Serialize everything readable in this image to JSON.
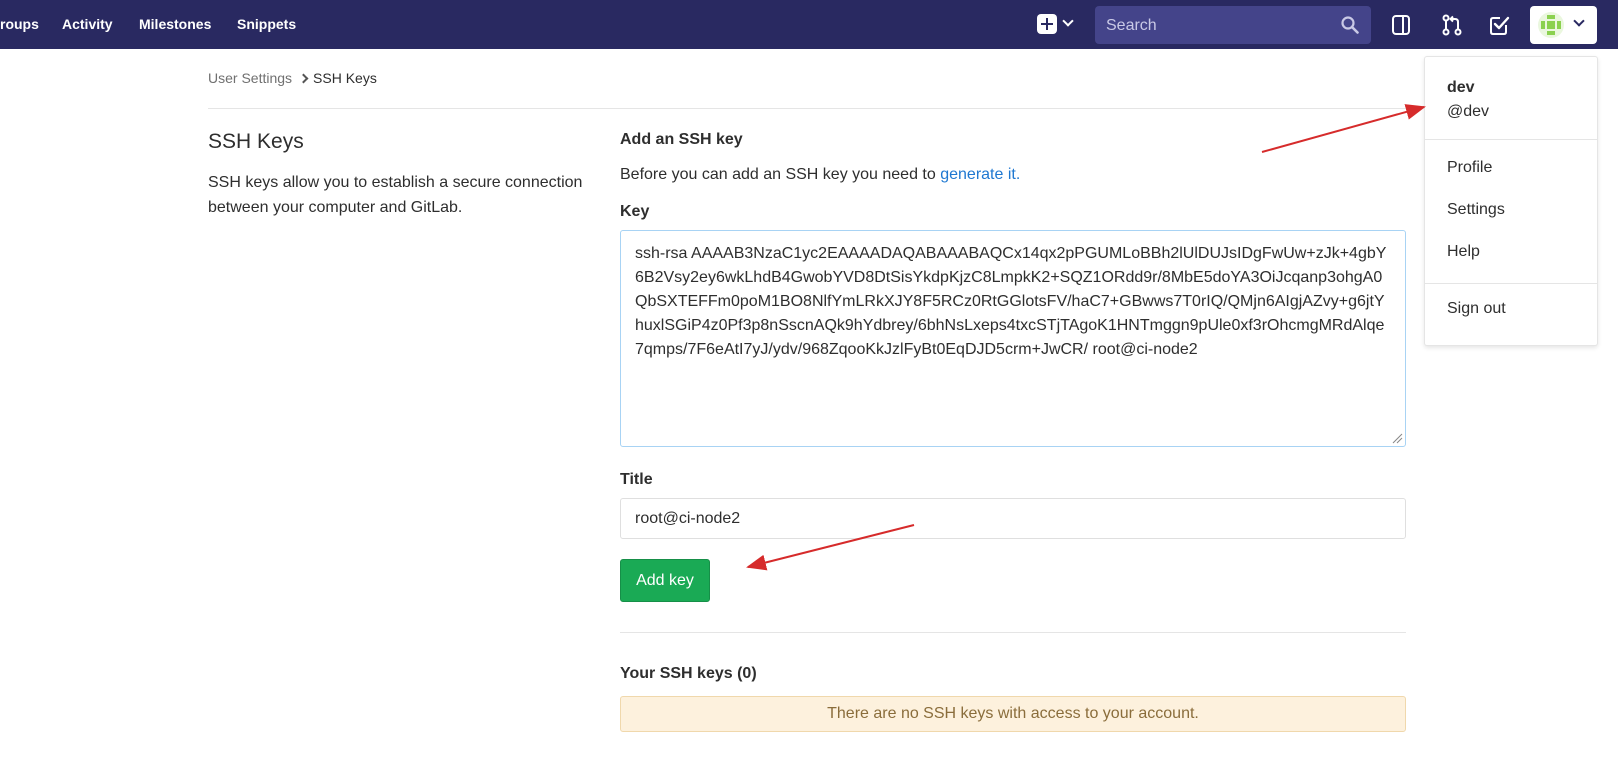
{
  "nav": {
    "items": [
      {
        "label": "roups"
      },
      {
        "label": "Activity"
      },
      {
        "label": "Milestones"
      },
      {
        "label": "Snippets"
      }
    ],
    "search_placeholder": "Search",
    "brand_color": "#292961"
  },
  "breadcrumb": {
    "parent": "User Settings",
    "current": "SSH Keys"
  },
  "section": {
    "title": "SSH Keys",
    "description": "SSH keys allow you to establish a secure connection between your computer and GitLab."
  },
  "form": {
    "heading": "Add an SSH key",
    "intro_text": "Before you can add an SSH key you need to",
    "intro_link": "generate it.",
    "key_label": "Key",
    "key_value": "ssh-rsa AAAAB3NzaC1yc2EAAAADAQABAAABAQCx14qx2pPGUMLoBBh2lUlDUJsIDgFwUw+zJk+4gbY6B2Vsy2ey6wkLhdB4GwobYVD8DtSisYkdpKjzC8LmpkK2+SQZ1ORdd9r/8MbE5doYA3OiJcqanp3ohgA0QbSXTEFFm0poM1BO8NlfYmLRkXJY8F5RCz0RtGGlotsFV/haC7+GBwws7T0rIQ/QMjn6AIgjAZvy+g6jtYhuxlSGiP4z0Pf3p8nSscnAQk9hYdbrey/6bhNsLxeps4txcSTjTAgoK1HNTmggn9pUle0xf3rOhcmgMRdAlqe7qmps/7F6eAtI7yJ/ydv/968ZqooKkJzlFyBt0EqDJD5crm+JwCR/ root@ci-node2",
    "title_label": "Title",
    "title_value": "root@ci-node2",
    "submit_label": "Add key",
    "submit_color": "#1aaa55"
  },
  "keys_list": {
    "heading": "Your SSH keys (0)",
    "empty_message": "There are no SSH keys with access to your account."
  },
  "user_menu": {
    "name": "dev",
    "username": "@dev",
    "items": [
      {
        "label": "Profile"
      },
      {
        "label": "Settings"
      },
      {
        "label": "Help"
      }
    ],
    "sign_out": "Sign out"
  }
}
